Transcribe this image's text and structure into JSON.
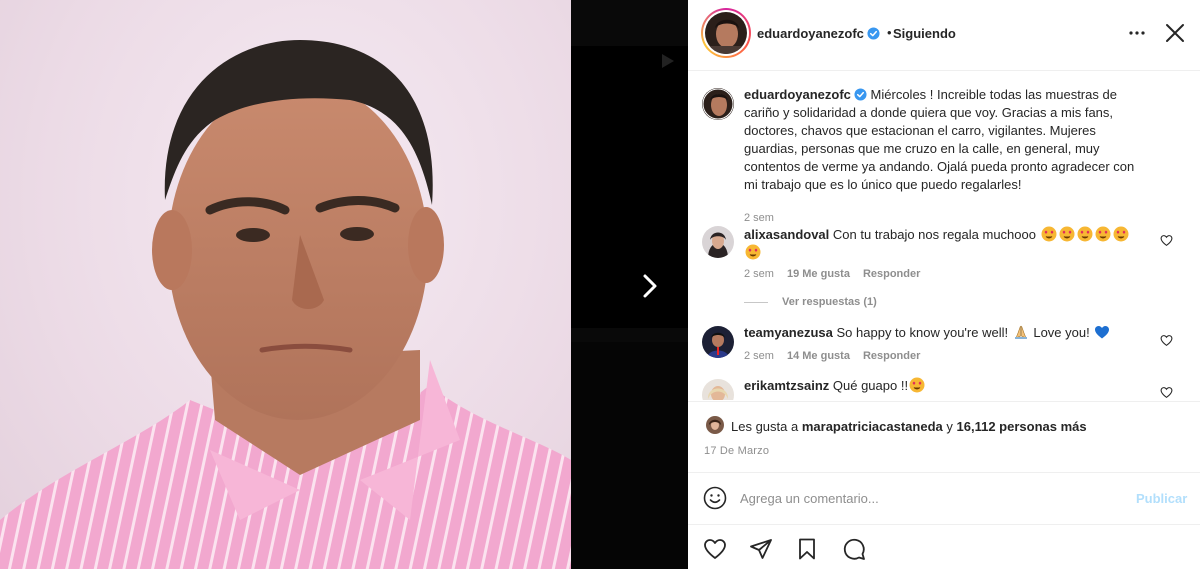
{
  "header": {
    "username": "eduardoyanezofc",
    "separator": "•",
    "follow_status": "Siguiendo",
    "icons": [
      "verified-badge-icon",
      "more-options-icon",
      "close-icon"
    ]
  },
  "caption": {
    "username": "eduardoyanezofc",
    "text": "Miércoles ! Increible todas las muestras de cariño y solidaridad a donde quiera que voy. Gracias a mis fans, doctores, chavos que estacionan el carro, vigilantes. Mujeres guardias, personas que me cruzo en la calle, en general, muy contentos de verme ya andando. Ojalá pueda pronto agradecer con mi trabajo que es lo único que puedo regalarles!",
    "time": "2 sem"
  },
  "comments": [
    {
      "username": "alixasandoval",
      "text": "Con tu trabajo nos regala muchooo",
      "emoji": [
        "heart-eyes",
        "heart-eyes",
        "heart-eyes",
        "heart-eyes",
        "heart-eyes",
        "heart-eyes"
      ],
      "time": "2 sem",
      "likes": "19 Me gusta",
      "reply": "Responder",
      "view_replies": "Ver respuestas (1)"
    },
    {
      "username": "teamyanezusa",
      "text": "So happy to know you're well!",
      "text_after": "Love you!",
      "emoji": [
        "folded-hands",
        "blue-heart"
      ],
      "time": "2 sem",
      "likes": "14 Me gusta",
      "reply": "Responder"
    },
    {
      "username": "erikamtzsainz",
      "text": "Qué guapo !!",
      "emoji": [
        "heart-eyes"
      ]
    }
  ],
  "likes": {
    "prefix": "Les gusta a",
    "user": "marapatriciacastaneda",
    "connector": "y",
    "count": "16,112 personas más"
  },
  "date": "17 De Marzo",
  "add_comment": {
    "placeholder": "Agrega un comentario...",
    "publish": "Publicar"
  },
  "colors": {
    "verified": "#3897f0",
    "publish_disabled": "#b2dffc",
    "muted_text": "#8e8e8e",
    "shirt_pink": "#f3a9d0",
    "background_dark": "#000000"
  }
}
